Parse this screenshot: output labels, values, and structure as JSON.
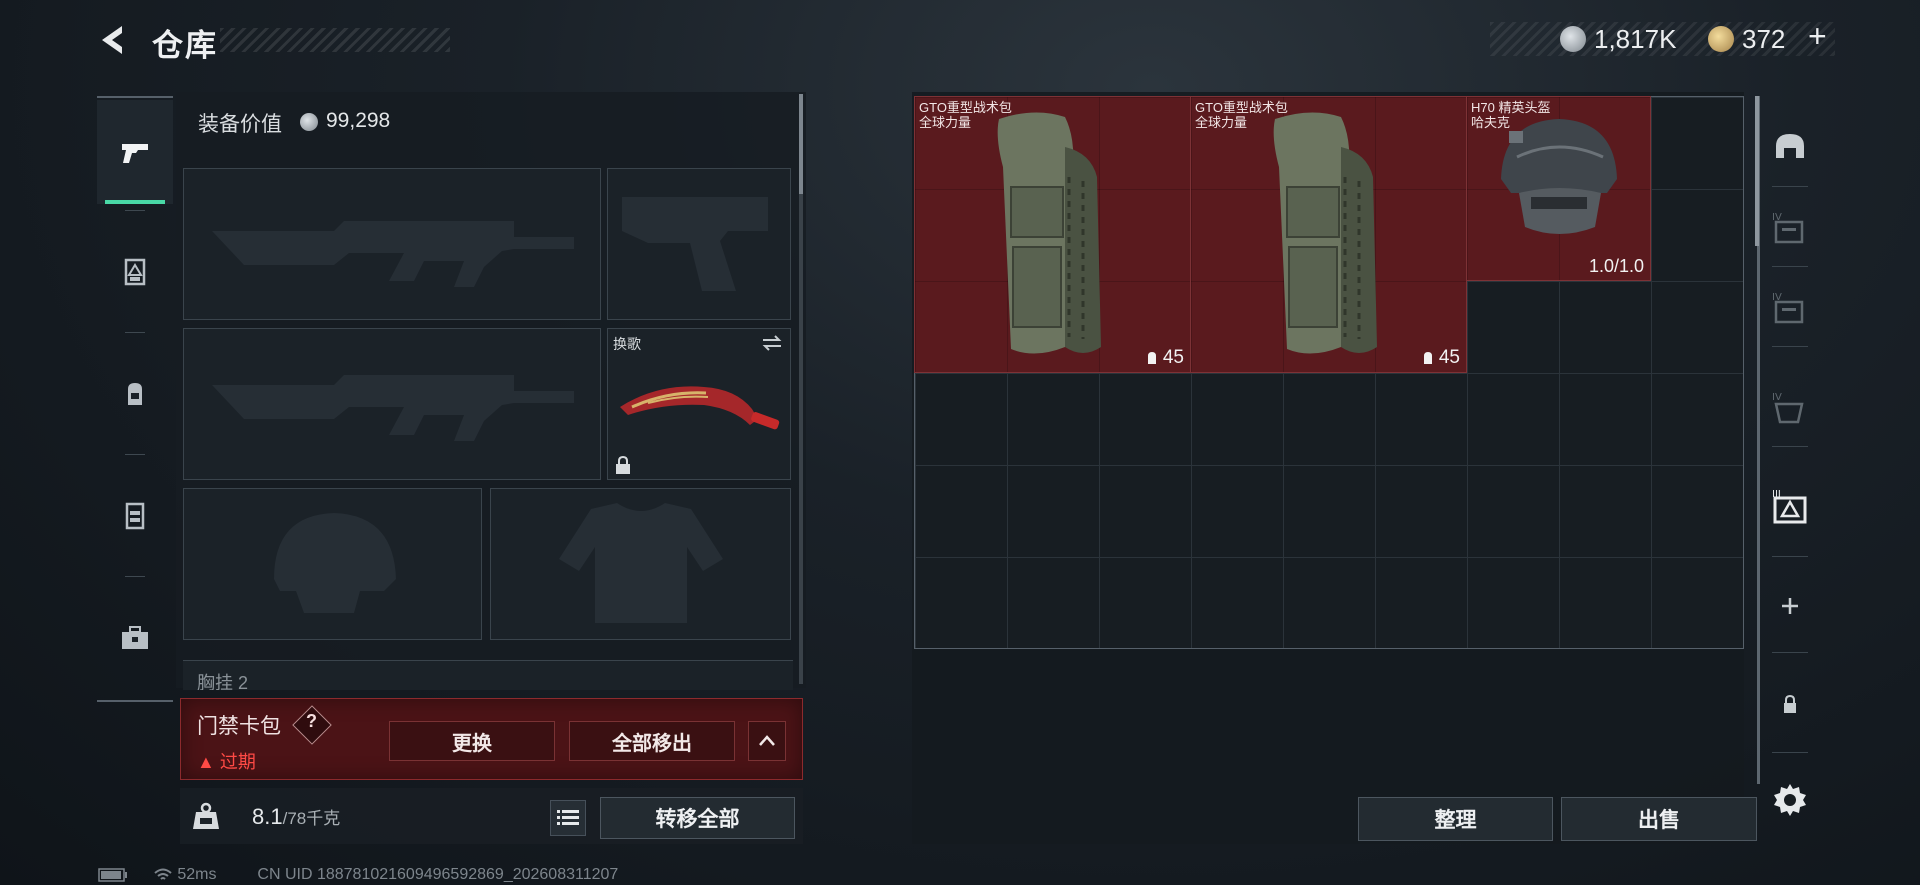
{
  "header": {
    "title": "仓库",
    "currency1": "1,817K",
    "currency2": "372",
    "currency2_add": "+"
  },
  "left_tabs": [
    "pistol-icon",
    "armor-icon",
    "backpack-icon",
    "vest-icon",
    "toolbox-icon"
  ],
  "loadout": {
    "equip_value_label": "装备价值",
    "equip_value": "99,298",
    "melee_label": "换歌",
    "chest_rig_label": "胸挂 2"
  },
  "card_pack": {
    "title": "门禁卡包",
    "help": "?",
    "status": "▲ 过期",
    "replace_label": "更换",
    "move_all_label": "全部移出",
    "collapse": "^"
  },
  "weight": {
    "current": "8.1",
    "max": "/78千克"
  },
  "transfer_all_label": "转移全部",
  "warehouse": {
    "items": [
      {
        "name": "GTO重型战术包",
        "brand": "全球力量",
        "capacity": "45"
      },
      {
        "name": "GTO重型战术包",
        "brand": "全球力量",
        "capacity": "45"
      },
      {
        "name": "H70 精英头盔",
        "brand": "哈夫克",
        "durability": "1.0/1.0"
      }
    ],
    "sort_label": "整理",
    "sell_label": "出售"
  },
  "right_tabs": [
    "helmet-icon",
    "warehouse-4-a-icon",
    "warehouse-4-b-icon",
    "warehouse-4-c-icon",
    "warehouse-3-active-icon",
    "add-icon",
    "lock-icon"
  ],
  "status_bar": {
    "ping": "52ms",
    "uid": "CN UID 188781021609496592869_202608311207"
  },
  "colors": {
    "accent": "#49d8a6",
    "item_bg": "#5a1a1e",
    "warning": "#ff4a45",
    "card_pack_bg": "#4b1316"
  }
}
